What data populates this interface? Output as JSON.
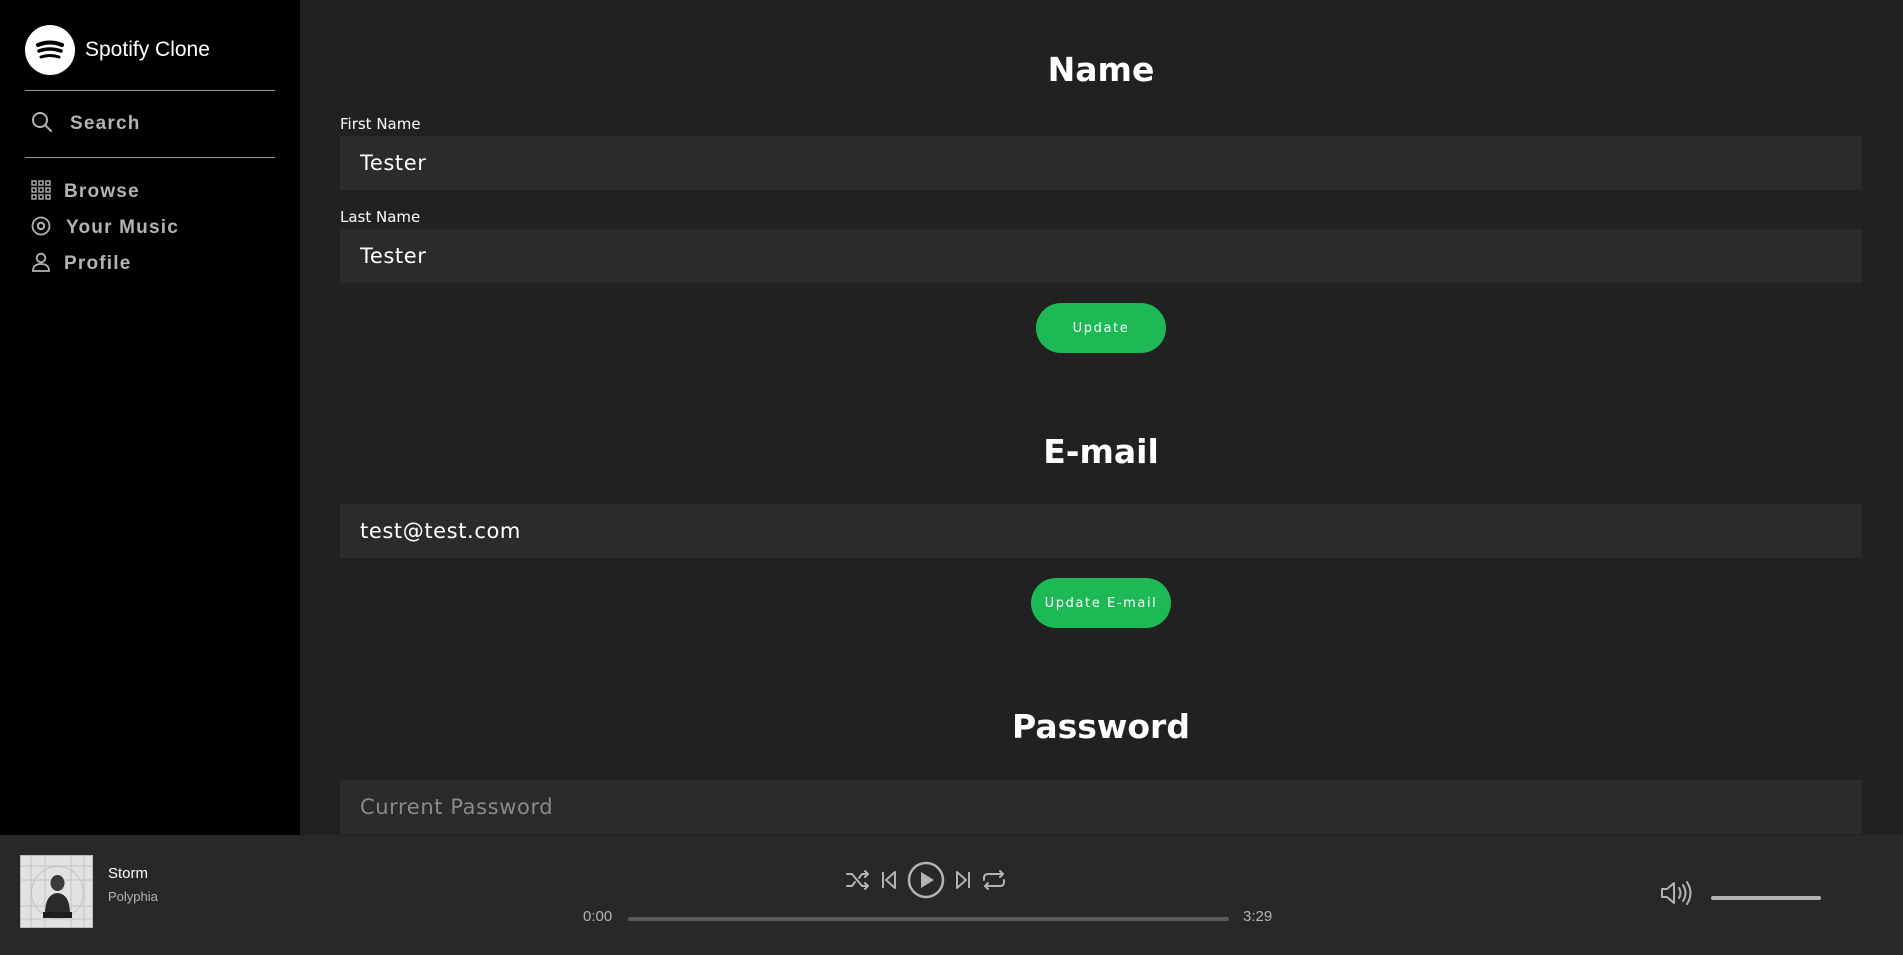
{
  "app": {
    "name": "Spotify Clone"
  },
  "sidebar": {
    "search_label": "Search",
    "items": [
      {
        "label": "Browse",
        "icon": "grid-icon"
      },
      {
        "label": "Your Music",
        "icon": "disc-icon"
      },
      {
        "label": "Profile",
        "icon": "user-icon"
      }
    ]
  },
  "profile": {
    "name_section": {
      "title": "Name",
      "first_name_label": "First Name",
      "first_name_value": "Tester",
      "last_name_label": "Last Name",
      "last_name_value": "Tester",
      "button": "Update"
    },
    "email_section": {
      "title": "E-mail",
      "email_value": "test@test.com",
      "button": "Update E-mail"
    },
    "password_section": {
      "title": "Password",
      "current_placeholder": "Current Password"
    }
  },
  "player": {
    "track_title": "Storm",
    "artist": "Polyphia",
    "current_time": "0:00",
    "total_time": "3:29",
    "progress": 0.0,
    "volume": 1.0
  },
  "colors": {
    "accent": "#1db954",
    "sidebar_bg": "#000000",
    "main_bg": "#212121",
    "player_bg": "#282828",
    "field_bg": "#2b2b2b"
  }
}
